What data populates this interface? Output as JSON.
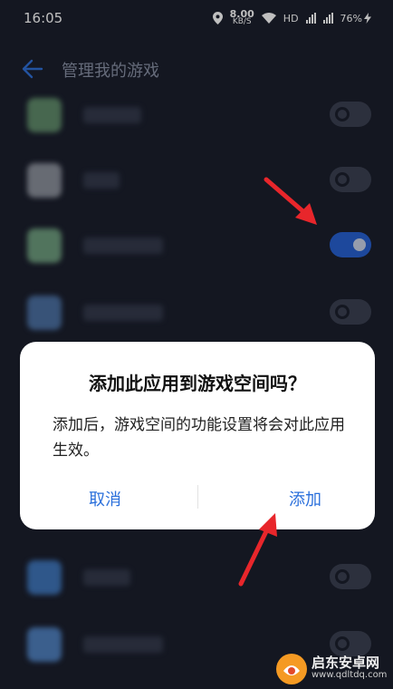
{
  "status_bar": {
    "time": "16:05",
    "speed_value": "8.00",
    "speed_unit": "KB/S",
    "hd_label": "HD",
    "battery_percent": "76%"
  },
  "header": {
    "title": "管理我的游戏"
  },
  "games": [
    {
      "enabled": false,
      "icon_color": "#5f8a6a"
    },
    {
      "enabled": false,
      "icon_color": "#8a8f9a"
    },
    {
      "enabled": true,
      "icon_color": "#6d9b7d"
    },
    {
      "enabled": false,
      "icon_color": "#4b6fa0"
    },
    {
      "enabled": false,
      "icon_color": "#3f74b8"
    },
    {
      "enabled": false,
      "icon_color": "#4f7fbd"
    }
  ],
  "dialog": {
    "title": "添加此应用到游戏空间吗？",
    "message": "添加后，游戏空间的功能设置将会对此应用生效。",
    "cancel_label": "取消",
    "confirm_label": "添加"
  },
  "watermark": {
    "name": "启东安卓网",
    "url": "www.qdltdq.com"
  },
  "colors": {
    "background": "#1b1f2d",
    "accent": "#2a6fdb",
    "toggle_on": "#2760d1",
    "arrow": "#e8262b"
  }
}
